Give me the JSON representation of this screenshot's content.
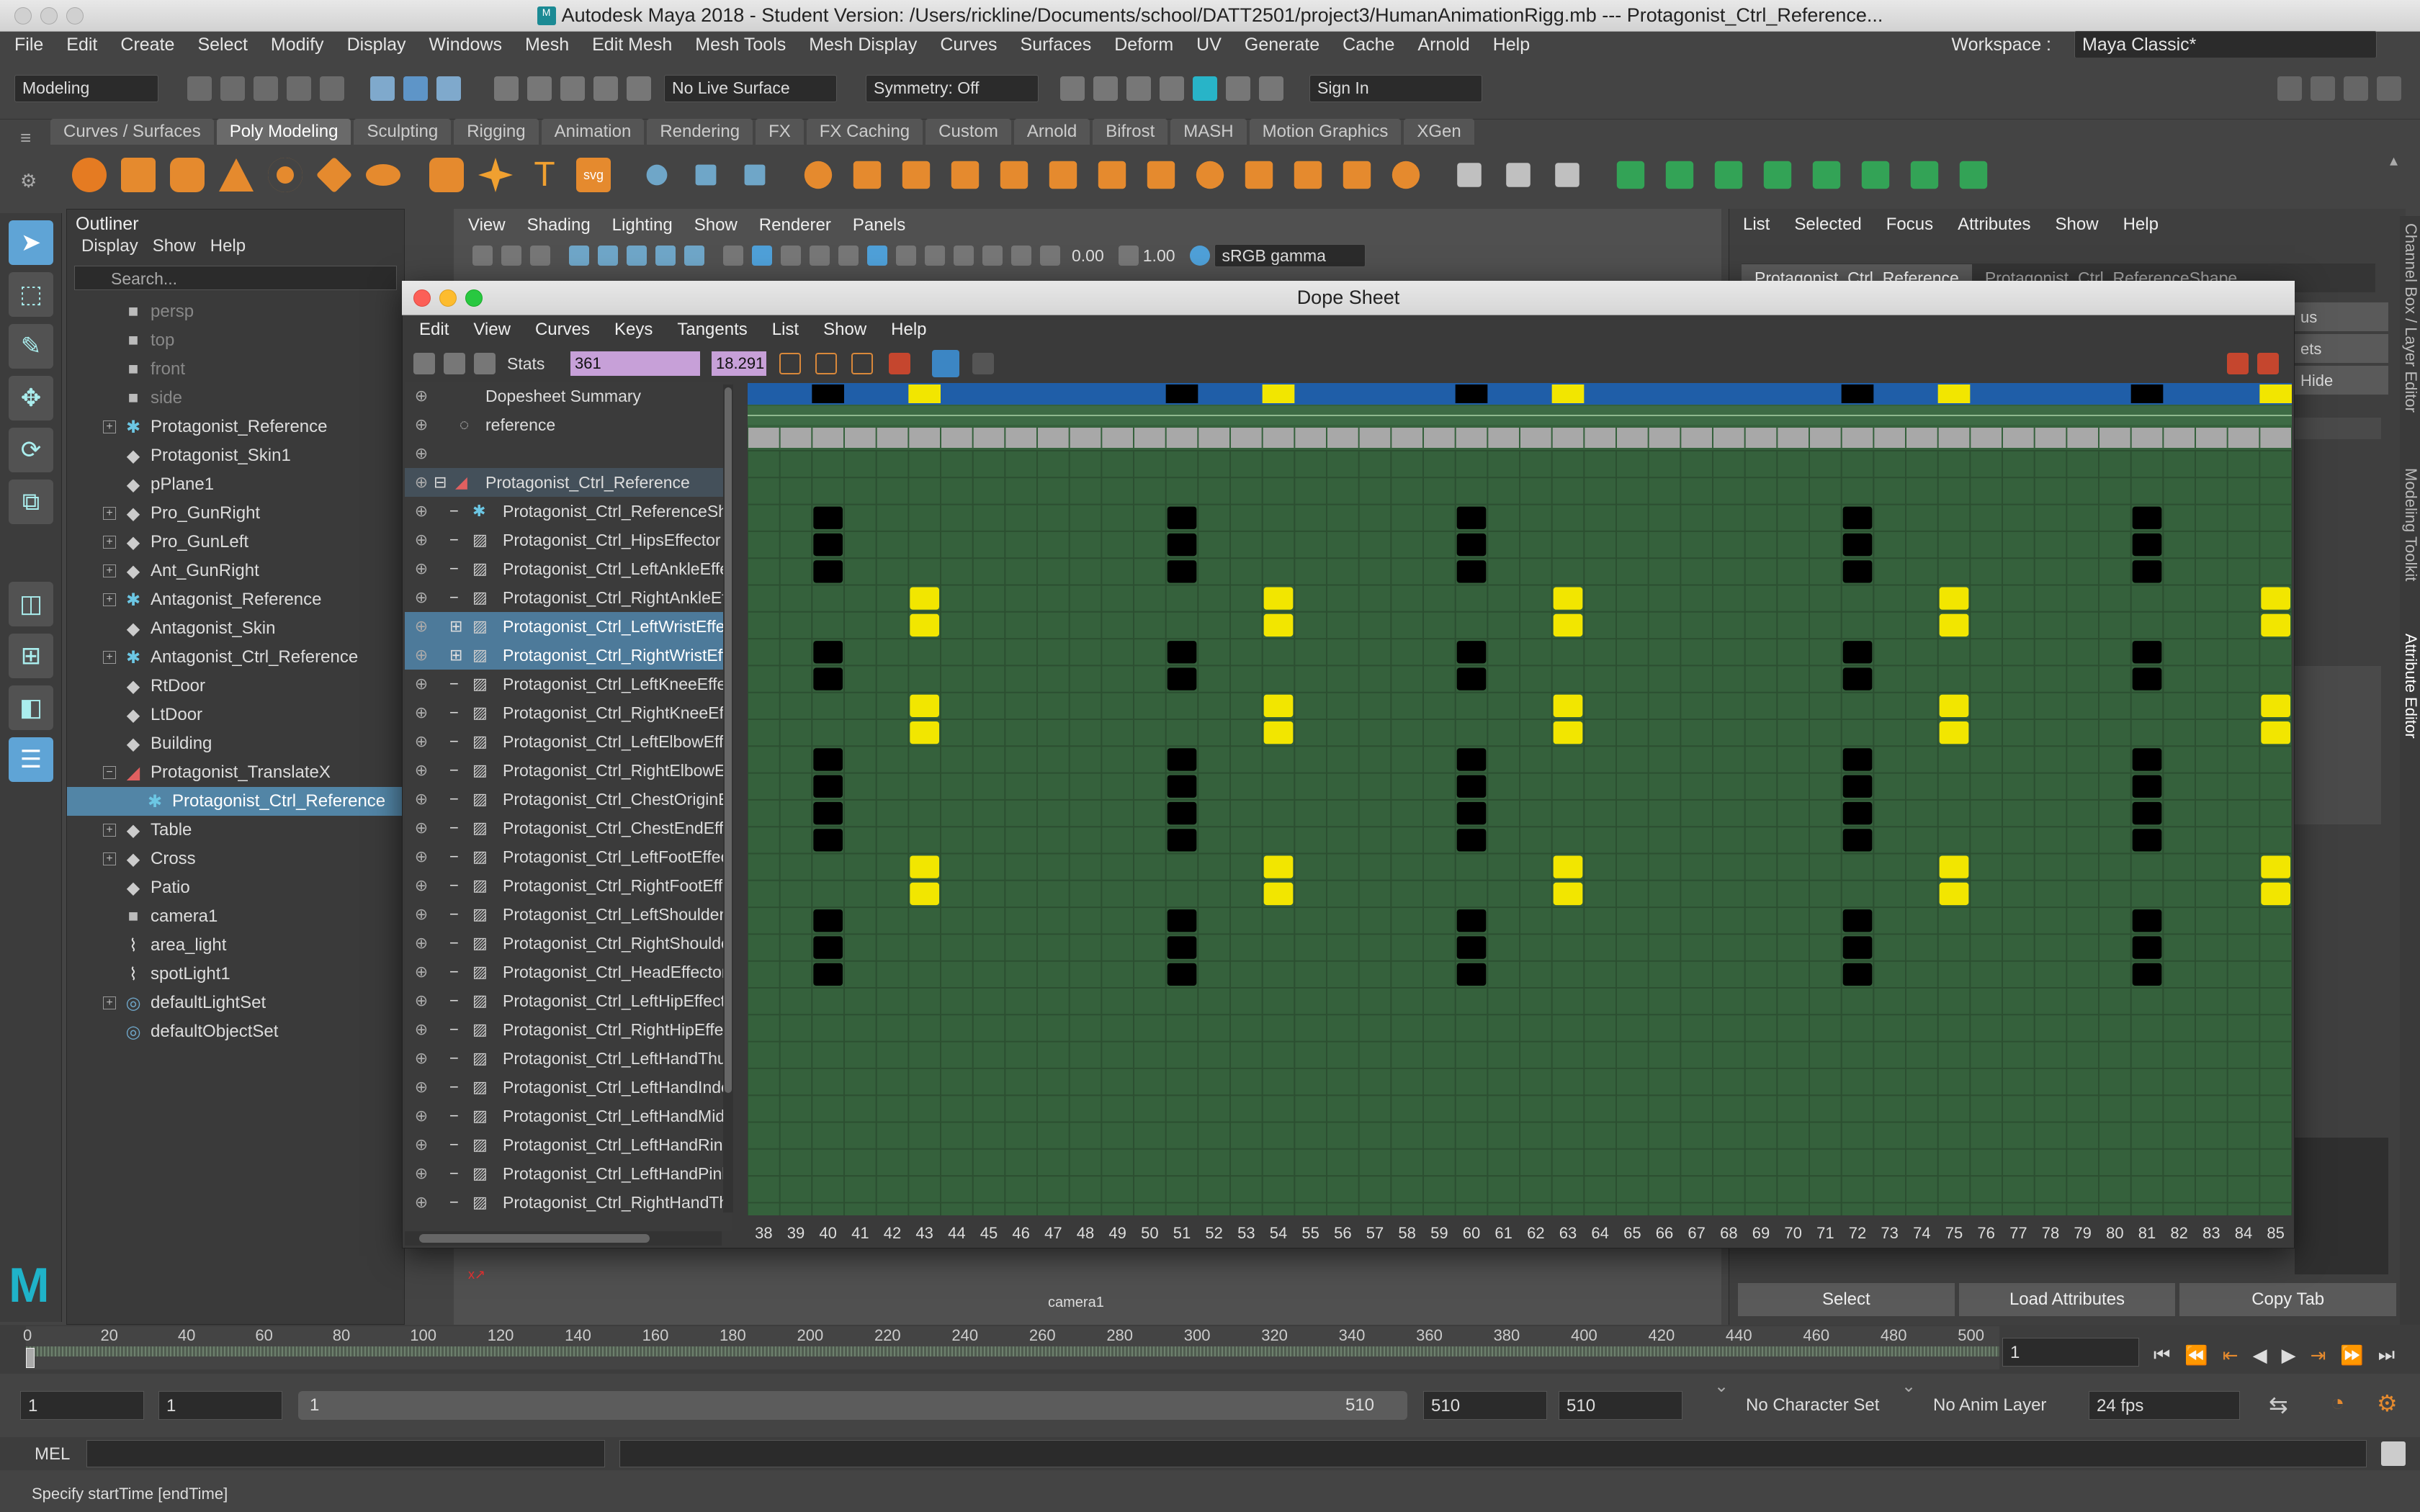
{
  "app": {
    "title": "Autodesk Maya 2018 - Student Version: /Users/rickline/Documents/school/DATT2501/project3/HumanAnimationRigg.mb   ---   Protagonist_Ctrl_Reference...",
    "menus": [
      "File",
      "Edit",
      "Create",
      "Select",
      "Modify",
      "Display",
      "Windows",
      "Mesh",
      "Edit Mesh",
      "Mesh Tools",
      "Mesh Display",
      "Curves",
      "Surfaces",
      "Deform",
      "UV",
      "Generate",
      "Cache",
      "Arnold",
      "Help"
    ],
    "workspace_label": "Workspace :",
    "workspace_value": "Maya Classic*"
  },
  "statusline": {
    "mode": "Modeling",
    "live_surface": "No Live Surface",
    "symmetry": "Symmetry: Off",
    "sign_in": "Sign In"
  },
  "shelf": {
    "tabs": [
      "Curves / Surfaces",
      "Poly Modeling",
      "Sculpting",
      "Rigging",
      "Animation",
      "Rendering",
      "FX",
      "FX Caching",
      "Custom",
      "Arnold",
      "Bifrost",
      "MASH",
      "Motion Graphics",
      "XGen"
    ],
    "active_tab": "Poly Modeling",
    "text_icon_label": "T",
    "svg_icon_label": "svg"
  },
  "outliner": {
    "title": "Outliner",
    "menu": [
      "Display",
      "Show",
      "Help"
    ],
    "search_placeholder": "Search...",
    "items": [
      {
        "label": "persp",
        "icon": "camera-icon",
        "dim": true,
        "expand": false
      },
      {
        "label": "top",
        "icon": "camera-icon",
        "dim": true,
        "expand": false
      },
      {
        "label": "front",
        "icon": "camera-icon",
        "dim": true,
        "expand": false
      },
      {
        "label": "side",
        "icon": "camera-icon",
        "dim": true,
        "expand": false
      },
      {
        "label": "Protagonist_Reference",
        "icon": "joint-icon",
        "expand": true
      },
      {
        "label": "Protagonist_Skin1",
        "icon": "mesh-icon",
        "expand": false
      },
      {
        "label": "pPlane1",
        "icon": "mesh-icon",
        "expand": false
      },
      {
        "label": "Pro_GunRight",
        "icon": "mesh-icon",
        "expand": true
      },
      {
        "label": "Pro_GunLeft",
        "icon": "mesh-icon",
        "expand": true
      },
      {
        "label": "Ant_GunRight",
        "icon": "mesh-icon",
        "expand": true
      },
      {
        "label": "Antagonist_Reference",
        "icon": "joint-icon",
        "expand": true
      },
      {
        "label": "Antagonist_Skin",
        "icon": "mesh-icon",
        "expand": false
      },
      {
        "label": "Antagonist_Ctrl_Reference",
        "icon": "joint-icon",
        "expand": true
      },
      {
        "label": "RtDoor",
        "icon": "mesh-icon",
        "expand": false
      },
      {
        "label": "LtDoor",
        "icon": "mesh-icon",
        "expand": false
      },
      {
        "label": "Building",
        "icon": "mesh-icon",
        "expand": false
      },
      {
        "label": "Protagonist_TranslateX",
        "icon": "curve-icon",
        "expand": true,
        "open": true
      },
      {
        "label": "Protagonist_Ctrl_Reference",
        "icon": "joint-icon",
        "selected": true,
        "indent": true
      },
      {
        "label": "Table",
        "icon": "mesh-icon",
        "expand": true
      },
      {
        "label": "Cross",
        "icon": "mesh-icon",
        "expand": true
      },
      {
        "label": "Patio",
        "icon": "mesh-icon",
        "expand": false
      },
      {
        "label": "camera1",
        "icon": "camera-icon",
        "expand": false
      },
      {
        "label": "area_light",
        "icon": "light-icon",
        "expand": false
      },
      {
        "label": "spotLight1",
        "icon": "light-icon",
        "expand": false
      },
      {
        "label": "defaultLightSet",
        "icon": "set-icon",
        "expand": true
      },
      {
        "label": "defaultObjectSet",
        "icon": "set-icon",
        "expand": false
      }
    ]
  },
  "viewport": {
    "menu": [
      "View",
      "Shading",
      "Lighting",
      "Show",
      "Renderer",
      "Panels"
    ],
    "exposure": "0.00",
    "gamma": "1.00",
    "color_space": "sRGB gamma",
    "camera_label": "camera1"
  },
  "attribute_editor": {
    "menu": [
      "List",
      "Selected",
      "Focus",
      "Attributes",
      "Show",
      "Help"
    ],
    "tabs": [
      "Protagonist_Ctrl_Reference",
      "Protagonist_Ctrl_ReferenceShape"
    ],
    "partial_labels": [
      "us",
      "ets",
      "Hide"
    ],
    "buttons": [
      "Select",
      "Load Attributes",
      "Copy Tab"
    ],
    "side_tabs": [
      "Channel Box / Layer Editor",
      "Modeling Toolkit",
      "Attribute Editor"
    ]
  },
  "dope_sheet": {
    "title": "Dope Sheet",
    "menu": [
      "Edit",
      "View",
      "Curves",
      "Keys",
      "Tangents",
      "List",
      "Show",
      "Help"
    ],
    "stats_label": "Stats",
    "stats_value": "361",
    "stats_value2": "18.291",
    "rows": [
      {
        "label": "Dopesheet Summary",
        "type": "summary"
      },
      {
        "label": "reference",
        "type": "layer"
      },
      {
        "label": "",
        "type": "blank"
      },
      {
        "label": "Protagonist_Ctrl_Reference",
        "type": "group"
      },
      {
        "label": "Protagonist_Ctrl_ReferenceShape",
        "type": "item",
        "key": "none"
      },
      {
        "label": "Protagonist_Ctrl_HipsEffector",
        "type": "item",
        "key": "black"
      },
      {
        "label": "Protagonist_Ctrl_LeftAnkleEffector",
        "type": "item",
        "key": "black"
      },
      {
        "label": "Protagonist_Ctrl_RightAnkleEffector",
        "type": "item",
        "key": "black"
      },
      {
        "label": "Protagonist_Ctrl_LeftWristEffector",
        "type": "item",
        "key": "yellow",
        "selected": true
      },
      {
        "label": "Protagonist_Ctrl_RightWristEffector",
        "type": "item",
        "key": "yellow",
        "selected": true
      },
      {
        "label": "Protagonist_Ctrl_LeftKneeEffector",
        "type": "item",
        "key": "black"
      },
      {
        "label": "Protagonist_Ctrl_RightKneeEffector",
        "type": "item",
        "key": "black"
      },
      {
        "label": "Protagonist_Ctrl_LeftElbowEffector",
        "type": "item",
        "key": "yellow"
      },
      {
        "label": "Protagonist_Ctrl_RightElbowEffector",
        "type": "item",
        "key": "yellow"
      },
      {
        "label": "Protagonist_Ctrl_ChestOriginEffector",
        "type": "item",
        "key": "black"
      },
      {
        "label": "Protagonist_Ctrl_ChestEndEffector",
        "type": "item",
        "key": "black"
      },
      {
        "label": "Protagonist_Ctrl_LeftFootEffector",
        "type": "item",
        "key": "black"
      },
      {
        "label": "Protagonist_Ctrl_RightFootEffector",
        "type": "item",
        "key": "black"
      },
      {
        "label": "Protagonist_Ctrl_LeftShoulderEffector",
        "type": "item",
        "key": "yellow"
      },
      {
        "label": "Protagonist_Ctrl_RightShoulderEffector",
        "type": "item",
        "key": "yellow"
      },
      {
        "label": "Protagonist_Ctrl_HeadEffector",
        "type": "item",
        "key": "black"
      },
      {
        "label": "Protagonist_Ctrl_LeftHipEffector",
        "type": "item",
        "key": "black"
      },
      {
        "label": "Protagonist_Ctrl_RightHipEffector",
        "type": "item",
        "key": "black"
      },
      {
        "label": "Protagonist_Ctrl_LeftHandThumb",
        "type": "item",
        "key": "none"
      },
      {
        "label": "Protagonist_Ctrl_LeftHandIndex",
        "type": "item",
        "key": "none"
      },
      {
        "label": "Protagonist_Ctrl_LeftHandMiddle",
        "type": "item",
        "key": "none"
      },
      {
        "label": "Protagonist_Ctrl_LeftHandRing",
        "type": "item",
        "key": "none"
      },
      {
        "label": "Protagonist_Ctrl_LeftHandPinky",
        "type": "item",
        "key": "none"
      },
      {
        "label": "Protagonist_Ctrl_RightHandThumb",
        "type": "item",
        "key": "none"
      }
    ],
    "frames": [
      "38",
      "39",
      "40",
      "41",
      "42",
      "43",
      "44",
      "45",
      "46",
      "47",
      "48",
      "49",
      "50",
      "51",
      "52",
      "53",
      "54",
      "55",
      "56",
      "57",
      "58",
      "59",
      "60",
      "61",
      "62",
      "63",
      "64",
      "65",
      "66",
      "67",
      "68",
      "69",
      "70",
      "71",
      "72",
      "73",
      "74",
      "75",
      "76",
      "77",
      "78",
      "79",
      "80",
      "81",
      "82",
      "83",
      "84",
      "85"
    ],
    "first_frame": 38,
    "last_frame": 85,
    "black_key_frames": [
      40,
      51,
      60,
      72,
      81
    ],
    "yellow_key_frames": [
      43,
      54,
      63,
      75,
      85
    ],
    "colors": {
      "grid": "#35613c",
      "key_black": "#000000",
      "key_yellow": "#f2e600",
      "summary_bar": "#1f5ea8"
    }
  },
  "timeline": {
    "ticks": [
      "0",
      "20",
      "40",
      "60",
      "80",
      "100",
      "120",
      "140",
      "160",
      "180",
      "200",
      "220",
      "240",
      "260",
      "280",
      "300",
      "320",
      "340",
      "360",
      "380",
      "400",
      "420",
      "440",
      "460",
      "480",
      "500"
    ],
    "current_frame": "1"
  },
  "range": {
    "start": "1",
    "playback_start": "1",
    "slider_start": "1",
    "slider_end": "510",
    "playback_end": "510",
    "end": "510",
    "character_set": "No Character Set",
    "anim_layer": "No Anim Layer",
    "fps": "24 fps"
  },
  "mel": {
    "label": "MEL",
    "help_line": "Specify startTime [endTime]"
  }
}
